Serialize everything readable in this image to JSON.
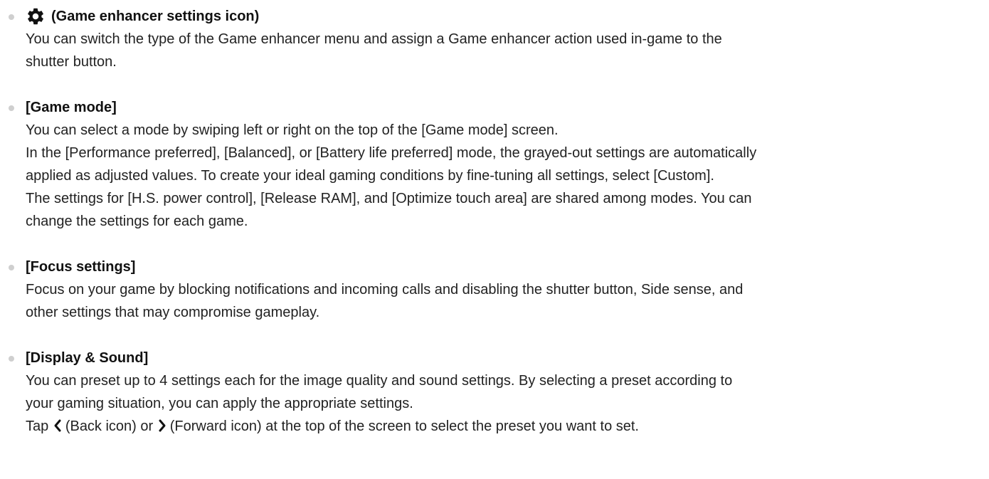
{
  "items": [
    {
      "title": "(Game enhancer settings icon)",
      "icon": "gear-icon",
      "paragraphs": [
        "You can switch the type of the Game enhancer menu and assign a Game enhancer action used in-game to the",
        "shutter button."
      ]
    },
    {
      "title": "[Game mode]",
      "paragraphs": [
        "You can select a mode by swiping left or right on the top of the [Game mode] screen.",
        "In the [Performance preferred], [Balanced], or [Battery life preferred] mode, the grayed-out settings are automatically",
        "applied as adjusted values. To create your ideal gaming conditions by fine-tuning all settings, select [Custom].",
        "The settings for [H.S. power control], [Release RAM], and [Optimize touch area] are shared among modes. You can",
        "change the settings for each game."
      ]
    },
    {
      "title": "[Focus settings]",
      "paragraphs": [
        "Focus on your game by blocking notifications and incoming calls and disabling the shutter button, Side sense, and",
        "other settings that may compromise gameplay."
      ]
    },
    {
      "title": "[Display & Sound]",
      "paragraphs": [
        "You can preset up to 4 settings each for the image quality and sound settings. By selecting a preset according to",
        "your gaming situation, you can apply the appropriate settings."
      ],
      "tap_line": {
        "prefix": "Tap",
        "back": "(Back icon) or",
        "forward": "(Forward icon) at the top of the screen to select the preset you want to set.",
        "back_icon": "chevron-left-icon",
        "forward_icon": "chevron-right-icon"
      }
    }
  ]
}
